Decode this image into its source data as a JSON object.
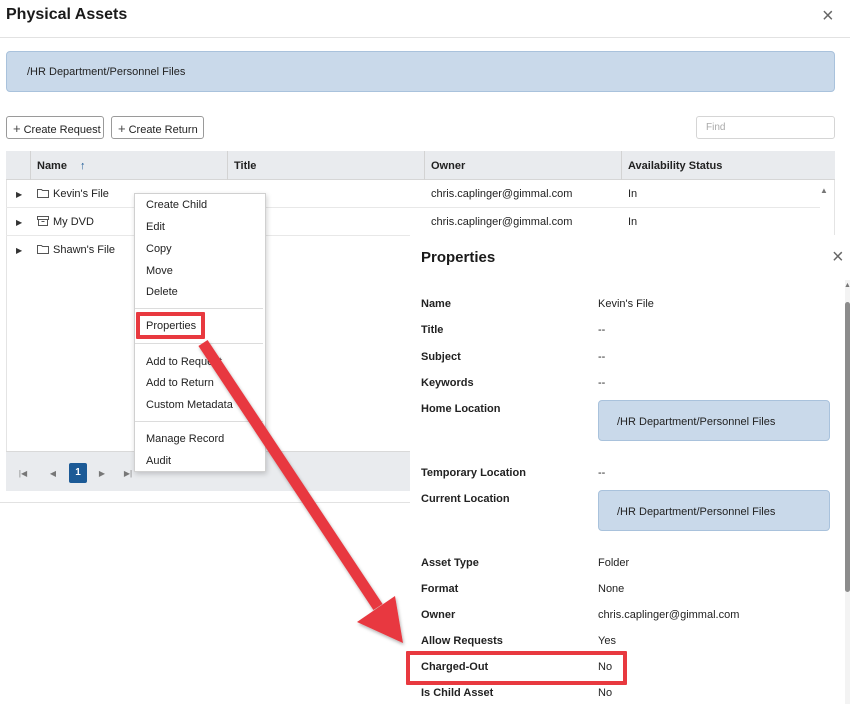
{
  "dialog": {
    "title": "Physical Assets",
    "close_icon": "×",
    "path": "/HR Department/Personnel Files"
  },
  "toolbar": {
    "create_request": "Create Request",
    "create_return": "Create Return",
    "plus_icon": "+",
    "find_placeholder": "Find"
  },
  "grid": {
    "columns": {
      "name": "Name",
      "sort_icon": "↑",
      "title": "Title",
      "owner": "Owner",
      "availability": "Availability Status"
    },
    "rows": [
      {
        "expand": "▶",
        "icon": "folder-icon",
        "name": "Kevin's File",
        "title": "",
        "owner": "chris.caplinger@gimmal.com",
        "status": "In"
      },
      {
        "expand": "▶",
        "icon": "media-box-icon",
        "name": "My DVD",
        "title": "",
        "owner": "chris.caplinger@gimmal.com",
        "status": "In"
      },
      {
        "expand": "▶",
        "icon": "folder-icon",
        "name": "Shawn's File",
        "title": "",
        "owner": "",
        "status": ""
      }
    ],
    "scroll_up_icon": "▲"
  },
  "pager": {
    "first": "|◀",
    "prev": "◀",
    "current": "1",
    "next": "▶",
    "last": "▶|"
  },
  "context_menu": {
    "items": [
      "Create Child",
      "Edit",
      "Copy",
      "Move",
      "Delete",
      "Properties",
      "Add to Request",
      "Add to Return",
      "Custom Metadata",
      "Manage Record",
      "Audit"
    ]
  },
  "properties": {
    "title": "Properties",
    "close_icon": "×",
    "fields": {
      "name": {
        "label": "Name",
        "value": "Kevin's File"
      },
      "title": {
        "label": "Title",
        "value": "--"
      },
      "subject": {
        "label": "Subject",
        "value": "--"
      },
      "keywords": {
        "label": "Keywords",
        "value": "--"
      },
      "home_location": {
        "label": "Home Location",
        "value": "/HR Department/Personnel Files"
      },
      "temporary_location": {
        "label": "Temporary Location",
        "value": "--"
      },
      "current_location": {
        "label": "Current Location",
        "value": "/HR Department/Personnel Files"
      },
      "asset_type": {
        "label": "Asset Type",
        "value": "Folder"
      },
      "format": {
        "label": "Format",
        "value": "None"
      },
      "owner": {
        "label": "Owner",
        "value": "chris.caplinger@gimmal.com"
      },
      "allow_requests": {
        "label": "Allow Requests",
        "value": "Yes"
      },
      "charged_out": {
        "label": "Charged-Out",
        "value": "No"
      },
      "is_child_asset": {
        "label": "Is Child Asset",
        "value": "No"
      }
    }
  },
  "colors": {
    "accent_blue": "#1c5a96",
    "location_bg": "#c9d9ea",
    "annotation_red": "#e8393f"
  }
}
